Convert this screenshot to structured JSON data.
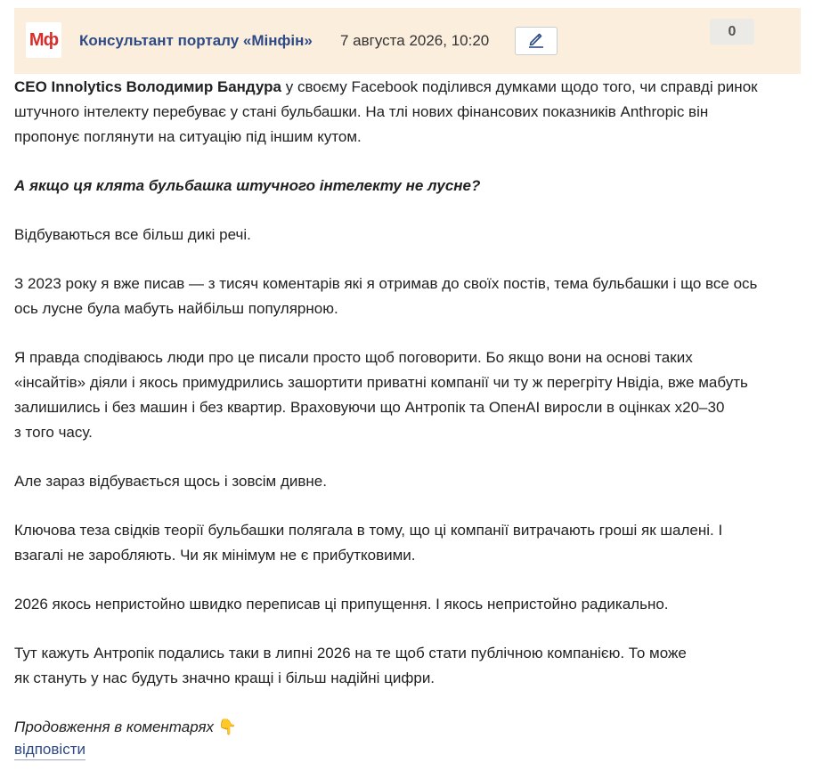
{
  "header": {
    "logo_text": "Мф",
    "author": "Консультант порталу «Мінфін»",
    "date": "7 августа 2026, 10:20",
    "edit_icon": "pencil-icon",
    "counter": "0"
  },
  "post": {
    "p1_strong": "CEO Innolytics Володимир Бандура",
    "p1_line1_rest": " у своєму Facebook поділився думками щодо того, чи справді ринок",
    "p1_line2": "штучного інтелекту перебуває у стані бульбашки. На тлі нових фінансових показників Anthropic він",
    "p1_line3": "пропонує поглянути на ситуацію під іншим кутом.",
    "question": "А якщо ця клята бульбашка штучного інтелекту не лусне?",
    "p2": "Відбуваються все більш дикі речі.",
    "p3_line1": "З 2023 року я вже писав — з тисяч коментарів які я отримав до своїх постів, тема бульбашки і що все ось",
    "p3_line2": "ось лусне була мабуть найбільш популярною.",
    "p4_line1": "Я правда сподіваюсь люди про це писали просто щоб поговорити. Бо якщо вони на основі таких",
    "p4_line2": "«інсайтів» діяли і якось примудрились зашортити приватні компанії чи ту ж перегріту Нвідіа, вже мабуть",
    "p4_line3": "залишились і без машин і без квартир. Враховуючи що Антропік та ОпенАІ виросли в оцінках х20–30",
    "p4_line4": "з того часу.",
    "p5": "Але зараз відбувається щось і зовсім дивне.",
    "p6_line1": "Ключова теза свідків теорії бульбашки полягала в тому, що ці компанії витрачають гроші як шалені. І",
    "p6_line2": "взагалі не заробляють. Чи як мінімум не є прибутковими.",
    "p7": "2026 якось непристойно швидко переписав ці припущення. І якось непристойно радикально.",
    "p8_line1": "Тут кажуть Антропік подались таки в липні 2026 на те щоб стати публічною компанією. То може",
    "p8_line2": "як стануть у нас будуть значно кращі і більш надійні цифри.",
    "continuation": "Продовження в коментарях",
    "continuation_emoji": "👇"
  },
  "actions": {
    "reply_label": "відповісти"
  },
  "colors": {
    "header_bg": "#fbeedd",
    "brand_red": "#d62e2b",
    "link_blue": "#2d4a86"
  }
}
